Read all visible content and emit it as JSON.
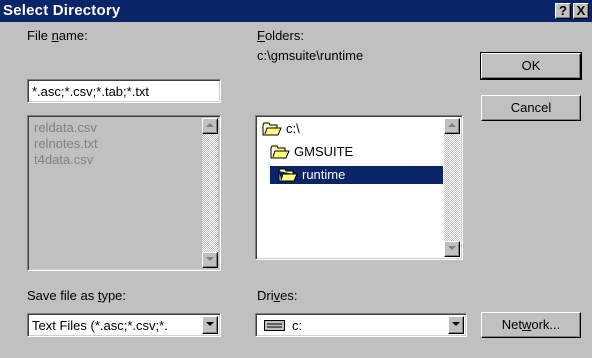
{
  "window": {
    "title": "Select Directory",
    "help_label": "?",
    "close_label": "X"
  },
  "file_name": {
    "label_pre": "File ",
    "label_key": "n",
    "label_post": "ame:",
    "value": "*.asc;*.csv;*.tab;*.txt",
    "files": [
      "reldata.csv",
      "relnotes.txt",
      "t4data.csv"
    ]
  },
  "folders": {
    "label_key": "F",
    "label_post": "olders:",
    "current_path": "c:\\gmsuite\\runtime",
    "items": [
      {
        "name": "c:\\",
        "icon": "open-folder-icon",
        "selected": false
      },
      {
        "name": "GMSUITE",
        "icon": "open-folder-icon",
        "selected": false
      },
      {
        "name": "runtime",
        "icon": "open-folder-icon",
        "selected": true
      }
    ]
  },
  "save_type": {
    "label_pre": "Save file as ",
    "label_key": "t",
    "label_post": "ype:",
    "value": "Text Files (*.asc;*.csv;*."
  },
  "drives": {
    "label_pre": "Dri",
    "label_key": "v",
    "label_post": "es:",
    "value": "c:",
    "icon": "drive-icon"
  },
  "buttons": {
    "ok": "OK",
    "cancel": "Cancel",
    "network_pre": "Net",
    "network_key": "w",
    "network_post": "ork..."
  },
  "colors": {
    "title_bar": "#0a246a",
    "face": "#c0c0c0",
    "selection": "#0a246a",
    "folder": "#ffff80"
  }
}
